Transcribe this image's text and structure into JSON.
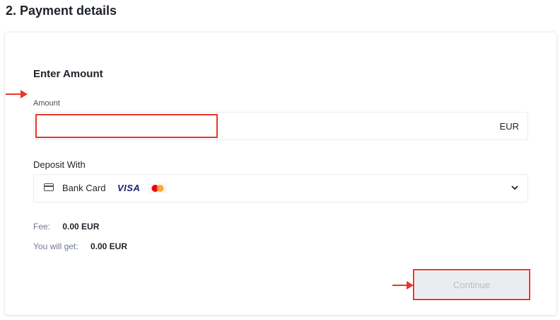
{
  "section": {
    "title": "2. Payment details"
  },
  "form": {
    "title": "Enter Amount",
    "amount": {
      "label": "Amount",
      "value": "",
      "placeholder": "",
      "currency": "EUR"
    },
    "deposit": {
      "label": "Deposit With",
      "selected": "Bank Card",
      "brands": [
        "VISA",
        "mastercard"
      ],
      "icon": "credit-card-icon"
    },
    "fee": {
      "label": "Fee:",
      "value": "0.00 EUR"
    },
    "you_get": {
      "label": "You will get:",
      "value": "0.00 EUR"
    },
    "continue_label": "Continue"
  },
  "colors": {
    "annotation": "#e8372c",
    "text_primary": "#1e2329",
    "text_secondary": "#707a8a",
    "button_disabled_bg": "#eaecef",
    "button_disabled_text": "#b7bdc6",
    "visa_blue": "#1a1f71",
    "mc_red": "#eb001b",
    "mc_orange": "#f79e1b"
  }
}
